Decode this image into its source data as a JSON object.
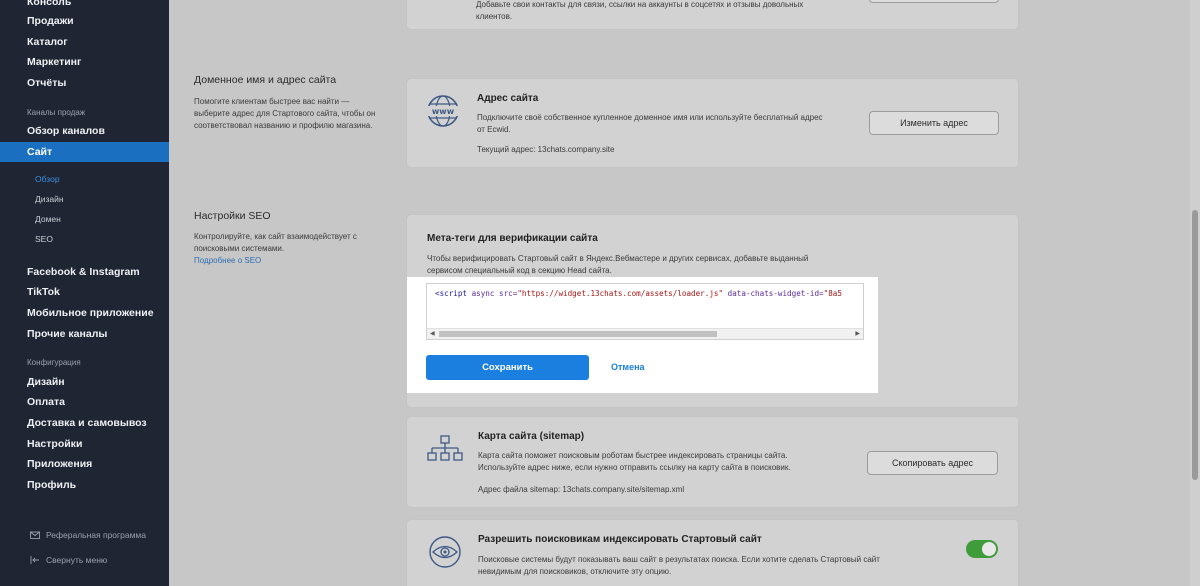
{
  "sidebar": {
    "items": {
      "console": "Консоль",
      "sales": "Продажи",
      "catalog": "Каталог",
      "marketing": "Маркетинг",
      "reports": "Отчёты",
      "channels_overview": "Обзор каналов",
      "site": "Сайт",
      "facebook": "Facebook & Instagram",
      "tiktok": "TikTok",
      "mobile_app": "Мобильное приложение",
      "other_channels": "Прочие каналы",
      "design": "Дизайн",
      "payment": "Оплата",
      "delivery": "Доставка и самовывоз",
      "settings": "Настройки",
      "apps": "Приложения",
      "profile": "Профиль"
    },
    "sections": {
      "sales_channels": "Каналы продаж",
      "configuration": "Конфигурация"
    },
    "sub": {
      "overview": "Обзор",
      "design": "Дизайн",
      "domain": "Домен",
      "seo": "SEO"
    },
    "bottom": {
      "referral": "Реферальная программа",
      "collapse": "Свернуть меню"
    }
  },
  "top_card": {
    "text_line1": "Добавьте свои контакты для связи, ссылки на аккаунты в соцсетях и отзывы довольных",
    "text_line2": "клиентов."
  },
  "domain_section": {
    "title": "Доменное имя и адрес сайта",
    "desc_line1": "Помогите клиентам быстрее вас найти —",
    "desc_line2": "выберите адрес для Стартового сайта, чтобы он",
    "desc_line3": "соответствовал названию и профилю магазина.",
    "card": {
      "icon_text": "www",
      "title": "Адрес сайта",
      "text_line1": "Подключите своё собственное купленное доменное имя или используйте бесплатный адрес",
      "text_line2": "от Ecwid.",
      "current_label": "Текущий адрес: 13chats.company.site",
      "button": "Изменить адрес"
    }
  },
  "seo_section": {
    "title": "Настройки SEO",
    "desc_line1": "Контролируйте, как сайт взаимодействует с",
    "desc_line2": "поисковыми системами.",
    "link": "Подробнее о SEO",
    "meta_card": {
      "title": "Мета-теги для верификации сайта",
      "text_line1": "Чтобы верифицировать Стартовый сайт в Яндекс.Вебмастере и других сервисах, добавьте выданный",
      "text_line2": "сервисом специальный код в секцию Head сайта.",
      "code": {
        "open": "<script",
        "attr1": " async",
        "attr2": " src=",
        "val2": "\"https://widget.13chats.com/assets/loader.js\"",
        "attr3": " data-chats-widget-id=",
        "val3": "\"8a5"
      },
      "save_button": "Сохранить",
      "cancel_link": "Отмена"
    },
    "sitemap_card": {
      "title": "Карта сайта (sitemap)",
      "text_line1": "Карта сайта поможет поисковым роботам быстрее индексировать страницы сайта.",
      "text_line2": "Используйте адрес ниже, если нужно отправить ссылку на карту сайта в поисковик.",
      "address": "Адрес файла sitemap: 13chats.company.site/sitemap.xml",
      "button": "Скопировать адрес"
    },
    "index_card": {
      "title": "Разрешить поисковикам индексировать Стартовый сайт",
      "text_line1": "Поисковые системы будут показывать ваш сайт в результатах поиска. Если хотите сделать Стартовый сайт",
      "text_line2": "невидимым для поисковиков, отключите эту опцию.",
      "toggle_on": true
    }
  },
  "colors": {
    "sidebar_bg": "#1f2532",
    "active_blue": "#1a6fc1",
    "primary_button": "#1b7fe0",
    "toggle_green": "#3f9c3a"
  }
}
